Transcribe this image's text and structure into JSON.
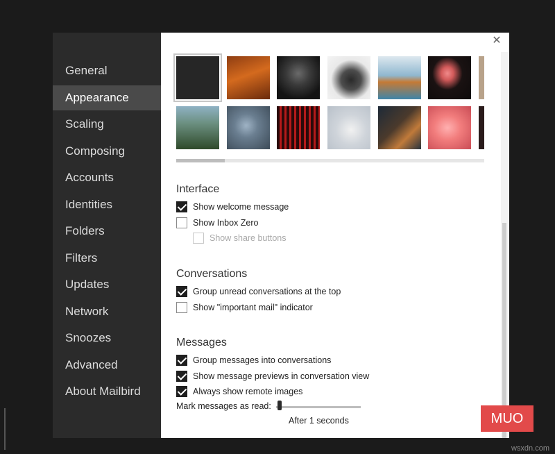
{
  "sidebar": {
    "items": [
      {
        "label": "General"
      },
      {
        "label": "Appearance"
      },
      {
        "label": "Scaling"
      },
      {
        "label": "Composing"
      },
      {
        "label": "Accounts"
      },
      {
        "label": "Identities"
      },
      {
        "label": "Folders"
      },
      {
        "label": "Filters"
      },
      {
        "label": "Updates"
      },
      {
        "label": "Network"
      },
      {
        "label": "Snoozes"
      },
      {
        "label": "Advanced"
      },
      {
        "label": "About Mailbird"
      }
    ],
    "active": "Appearance"
  },
  "close_icon": "close-icon",
  "themes": {
    "selected_index": 0,
    "row1": [
      "dark-solid",
      "autumn-forest",
      "robot-dark",
      "dog-sculpture",
      "dog-beach",
      "flamingo-dark",
      "partial-thumb"
    ],
    "row2": [
      "waterfall-bridge",
      "network-map",
      "red-circuit",
      "white-cat",
      "cat-window",
      "flamingo-pink",
      "partial-thumb"
    ]
  },
  "interface": {
    "title": "Interface",
    "options": [
      {
        "label": "Show welcome message",
        "checked": true
      },
      {
        "label": "Show Inbox Zero",
        "checked": false
      },
      {
        "label": "Show share buttons",
        "checked": false,
        "disabled": true
      }
    ]
  },
  "conversations": {
    "title": "Conversations",
    "options": [
      {
        "label": "Group unread conversations at the top",
        "checked": true
      },
      {
        "label": "Show \"important mail\" indicator",
        "checked": false
      }
    ]
  },
  "messages": {
    "title": "Messages",
    "options": [
      {
        "label": "Group messages into conversations",
        "checked": true
      },
      {
        "label": "Show message previews in conversation view",
        "checked": true
      },
      {
        "label": "Always show remote images",
        "checked": true
      }
    ],
    "mark_read_label": "Mark messages as read:",
    "mark_read_value": "After 1 seconds",
    "mark_read_seconds": 1
  },
  "watermark": "MUO",
  "footer_url": "wsxdn.com",
  "colors": {
    "sidebar_bg": "#2b2b2b",
    "active_bg": "#4a4a4a",
    "page_bg": "#1b1b1b",
    "watermark_bg": "#e24a4a"
  }
}
